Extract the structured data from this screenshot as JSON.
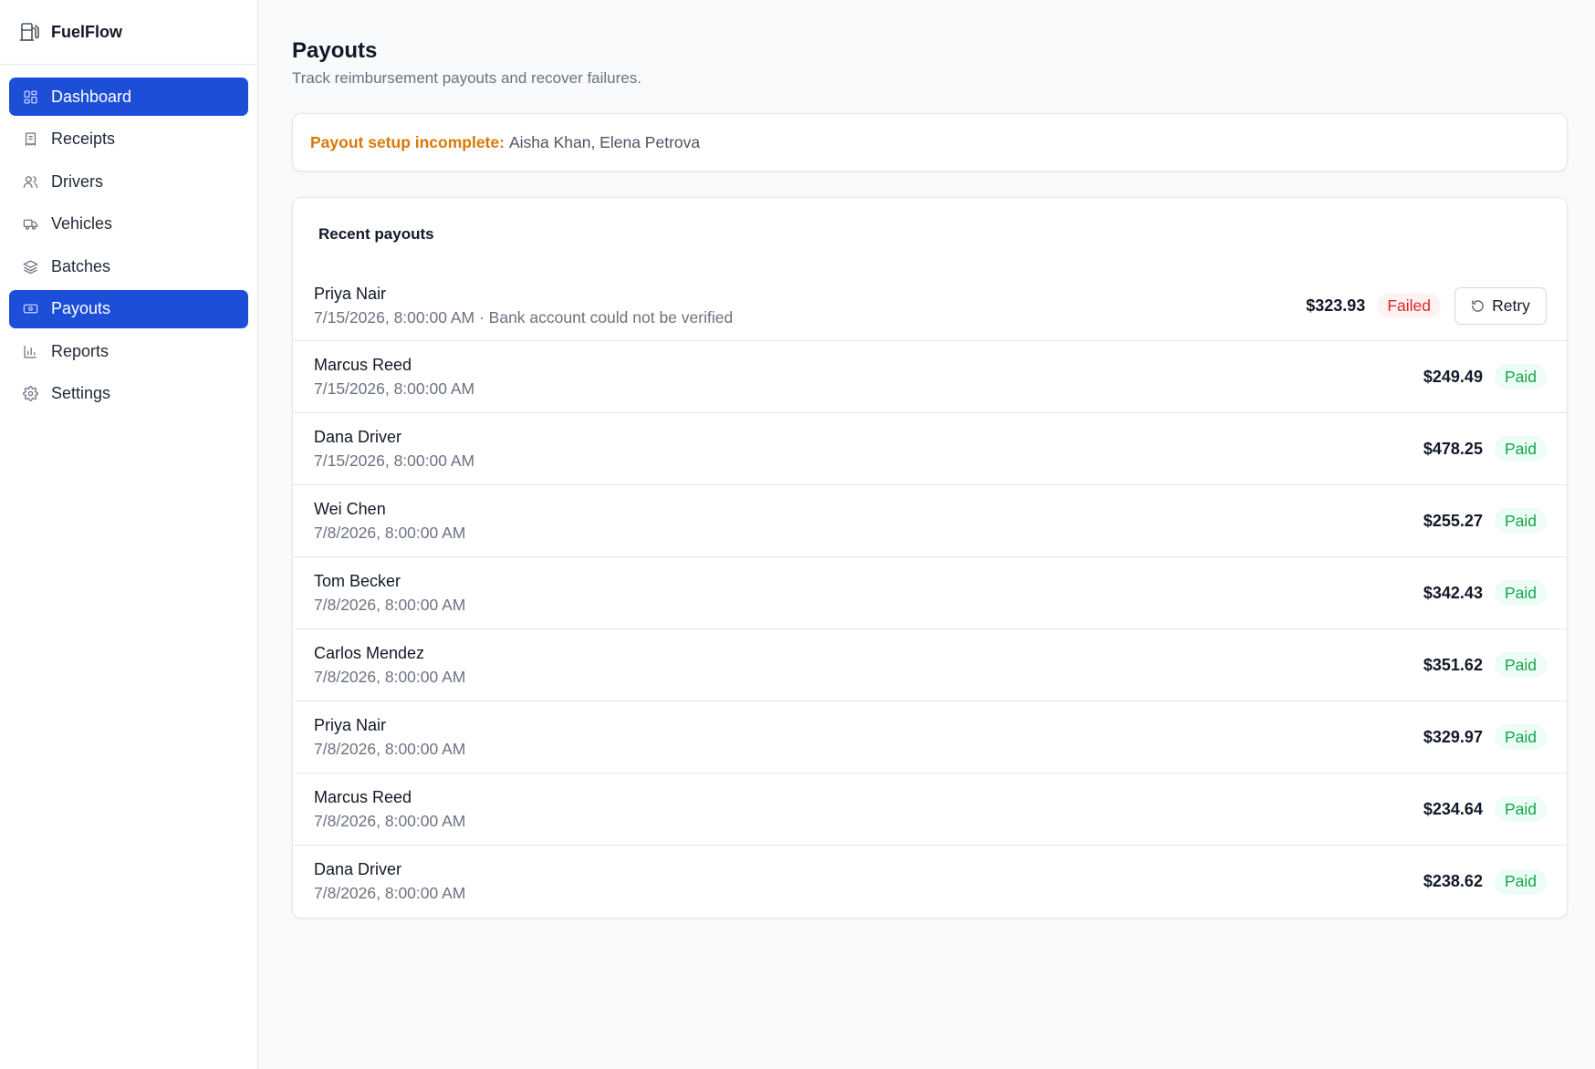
{
  "app": {
    "name": "FuelFlow",
    "icon": "fuel-pump-icon"
  },
  "sidebar": {
    "items": [
      {
        "label": "Dashboard",
        "icon": "dashboard-grid-icon",
        "active": true
      },
      {
        "label": "Receipts",
        "icon": "receipt-icon",
        "active": false
      },
      {
        "label": "Drivers",
        "icon": "users-icon",
        "active": false
      },
      {
        "label": "Vehicles",
        "icon": "truck-icon",
        "active": false
      },
      {
        "label": "Batches",
        "icon": "layers-icon",
        "active": false
      },
      {
        "label": "Payouts",
        "icon": "banknote-icon",
        "active": true
      },
      {
        "label": "Reports",
        "icon": "bar-chart-icon",
        "active": false
      },
      {
        "label": "Settings",
        "icon": "gear-icon",
        "active": false
      }
    ]
  },
  "header": {
    "title": "Payouts",
    "subtitle": "Track reimbursement payouts and recover failures."
  },
  "alert": {
    "label": "Payout setup incomplete:",
    "names": "Aisha Khan, Elena Petrova"
  },
  "payouts": {
    "title": "Recent payouts",
    "retry_label": "Retry",
    "rows": [
      {
        "name": "Priya Nair",
        "meta": "7/15/2026, 8:00:00 AM · Bank account could not be verified",
        "amount": "$323.93",
        "status": "Failed"
      },
      {
        "name": "Marcus Reed",
        "meta": "7/15/2026, 8:00:00 AM",
        "amount": "$249.49",
        "status": "Paid"
      },
      {
        "name": "Dana Driver",
        "meta": "7/15/2026, 8:00:00 AM",
        "amount": "$478.25",
        "status": "Paid"
      },
      {
        "name": "Wei Chen",
        "meta": "7/8/2026, 8:00:00 AM",
        "amount": "$255.27",
        "status": "Paid"
      },
      {
        "name": "Tom Becker",
        "meta": "7/8/2026, 8:00:00 AM",
        "amount": "$342.43",
        "status": "Paid"
      },
      {
        "name": "Carlos Mendez",
        "meta": "7/8/2026, 8:00:00 AM",
        "amount": "$351.62",
        "status": "Paid"
      },
      {
        "name": "Priya Nair",
        "meta": "7/8/2026, 8:00:00 AM",
        "amount": "$329.97",
        "status": "Paid"
      },
      {
        "name": "Marcus Reed",
        "meta": "7/8/2026, 8:00:00 AM",
        "amount": "$234.64",
        "status": "Paid"
      },
      {
        "name": "Dana Driver",
        "meta": "7/8/2026, 8:00:00 AM",
        "amount": "$238.62",
        "status": "Paid"
      }
    ]
  },
  "colors": {
    "accent": "#1d4ed8",
    "warning": "#d97706",
    "success": "#16a34a",
    "danger": "#dc2626"
  }
}
